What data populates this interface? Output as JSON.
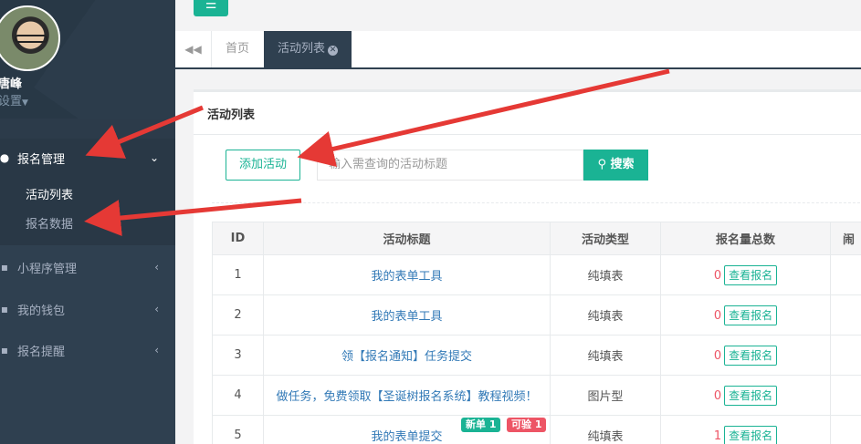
{
  "user": {
    "name": "唐峰",
    "settings": "设置"
  },
  "sidebar": {
    "items": [
      {
        "label": "报名管理",
        "icon": "users-icon"
      },
      {
        "label": "小程序管理",
        "icon": "user-icon"
      },
      {
        "label": "我的钱包",
        "icon": "user-icon"
      },
      {
        "label": "报名提醒",
        "icon": "user-icon"
      }
    ],
    "subitems": [
      "活动列表",
      "报名数据"
    ]
  },
  "tabs": [
    {
      "label": "首页"
    },
    {
      "label": "活动列表"
    }
  ],
  "panel": {
    "title": "活动列表",
    "add_label": "添加活动",
    "search_placeholder": "输入需查询的活动标题",
    "search_label": "搜索"
  },
  "table": {
    "headers": [
      "ID",
      "活动标题",
      "活动类型",
      "报名量总数",
      "闹"
    ],
    "view_label": "查看报名",
    "rows": [
      {
        "id": "1",
        "title": "我的表单工具",
        "type": "纯填表",
        "count": "0"
      },
      {
        "id": "2",
        "title": "我的表单工具",
        "type": "纯填表",
        "count": "0"
      },
      {
        "id": "3",
        "title": "领【报名通知】任务提交",
        "type": "纯填表",
        "count": "0"
      },
      {
        "id": "4",
        "title": "做任务，免费领取【圣诞树报名系统】教程视频！",
        "type": "图片型",
        "count": "0"
      },
      {
        "id": "5",
        "title": "我的表单提交",
        "type": "纯填表",
        "count": "1",
        "badge_new": "新单 1",
        "badge_verify": "可验 1"
      }
    ]
  },
  "colors": {
    "accent": "#1ab394",
    "sidebar": "#2f4050",
    "danger": "#ed5565",
    "annotation": "#e53935"
  }
}
